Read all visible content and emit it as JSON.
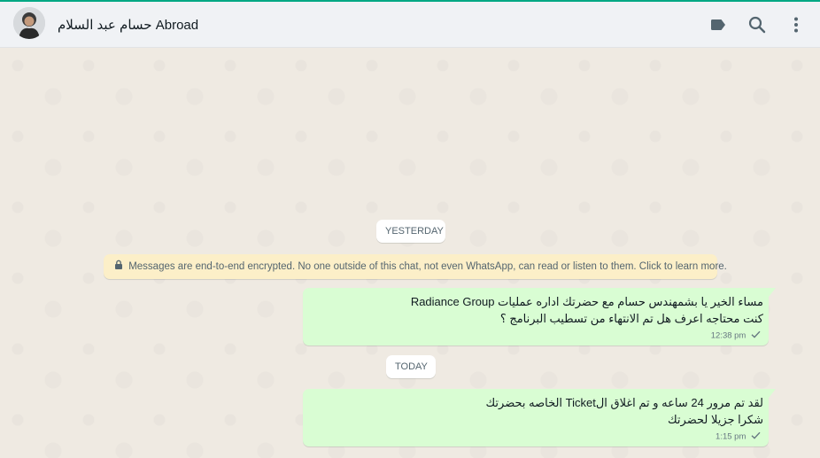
{
  "header": {
    "contact_name": "حسام عبد السلام Abroad",
    "icons": [
      "label-icon",
      "search-icon",
      "menu-icon"
    ]
  },
  "chat": {
    "date_yesterday": "YESTERDAY",
    "date_today": "TODAY",
    "encryption_notice": "Messages are end-to-end encrypted. No one outside of this chat, not even WhatsApp, can read or listen to them. Click to learn more.",
    "messages": [
      {
        "lines": [
          "مساء الخير يا بشمهندس حسام مع حضرتك اداره عمليات Radiance Group",
          "كنت محتاجه اعرف هل تم الانتهاء من تسطيب البرنامج ؟"
        ],
        "time": "12:38 pm",
        "status": "sent"
      },
      {
        "lines": [
          "لقد تم مرور 24 ساعه و تم اغلاق الTicket الخاصه بحضرتك",
          "شكرا جزيلا لحضرتك"
        ],
        "time": "1:15 pm",
        "status": "sent"
      }
    ]
  },
  "colors": {
    "accent": "#00a884",
    "outgoing_bubble": "#d9fdd3",
    "chat_bg": "#efeae2",
    "encryption_bg": "#fcefc8"
  }
}
